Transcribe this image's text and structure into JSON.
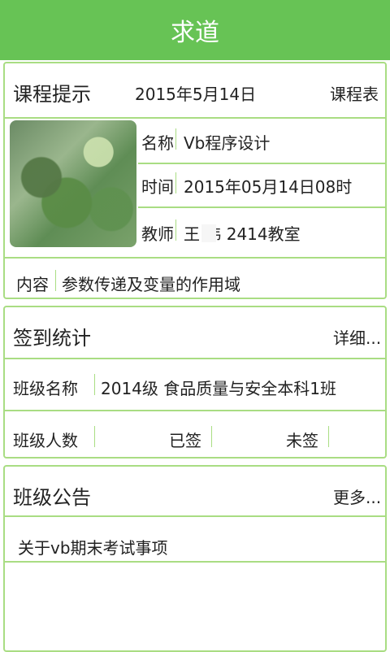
{
  "app": {
    "title": "求道"
  },
  "course_tip": {
    "title": "课程提示",
    "date": "2015年5月14日",
    "schedule_link": "课程表",
    "rows": [
      {
        "label": "名称",
        "value": "Vb程序设计"
      },
      {
        "label": "时间",
        "value": "2015年05月14日08时"
      },
      {
        "label": "教师",
        "value": "王  伟    2414教室"
      }
    ],
    "content": {
      "label": "内容",
      "value": "参数传递及变量的作用域"
    }
  },
  "checkin": {
    "title": "签到统计",
    "details_link": "详细...",
    "class_name_label": "班级名称",
    "class_name_value": "2014级 食品质量与安全本科1班",
    "class_size_label": "班级人数",
    "signed_label": "已签",
    "unsigned_label": "未签"
  },
  "notice": {
    "title": "班级公告",
    "more_link": "更多...",
    "items": [
      "关于vb期末考试事项"
    ]
  },
  "colors": {
    "topbar": "#67c355",
    "border": "#a9dd83"
  }
}
